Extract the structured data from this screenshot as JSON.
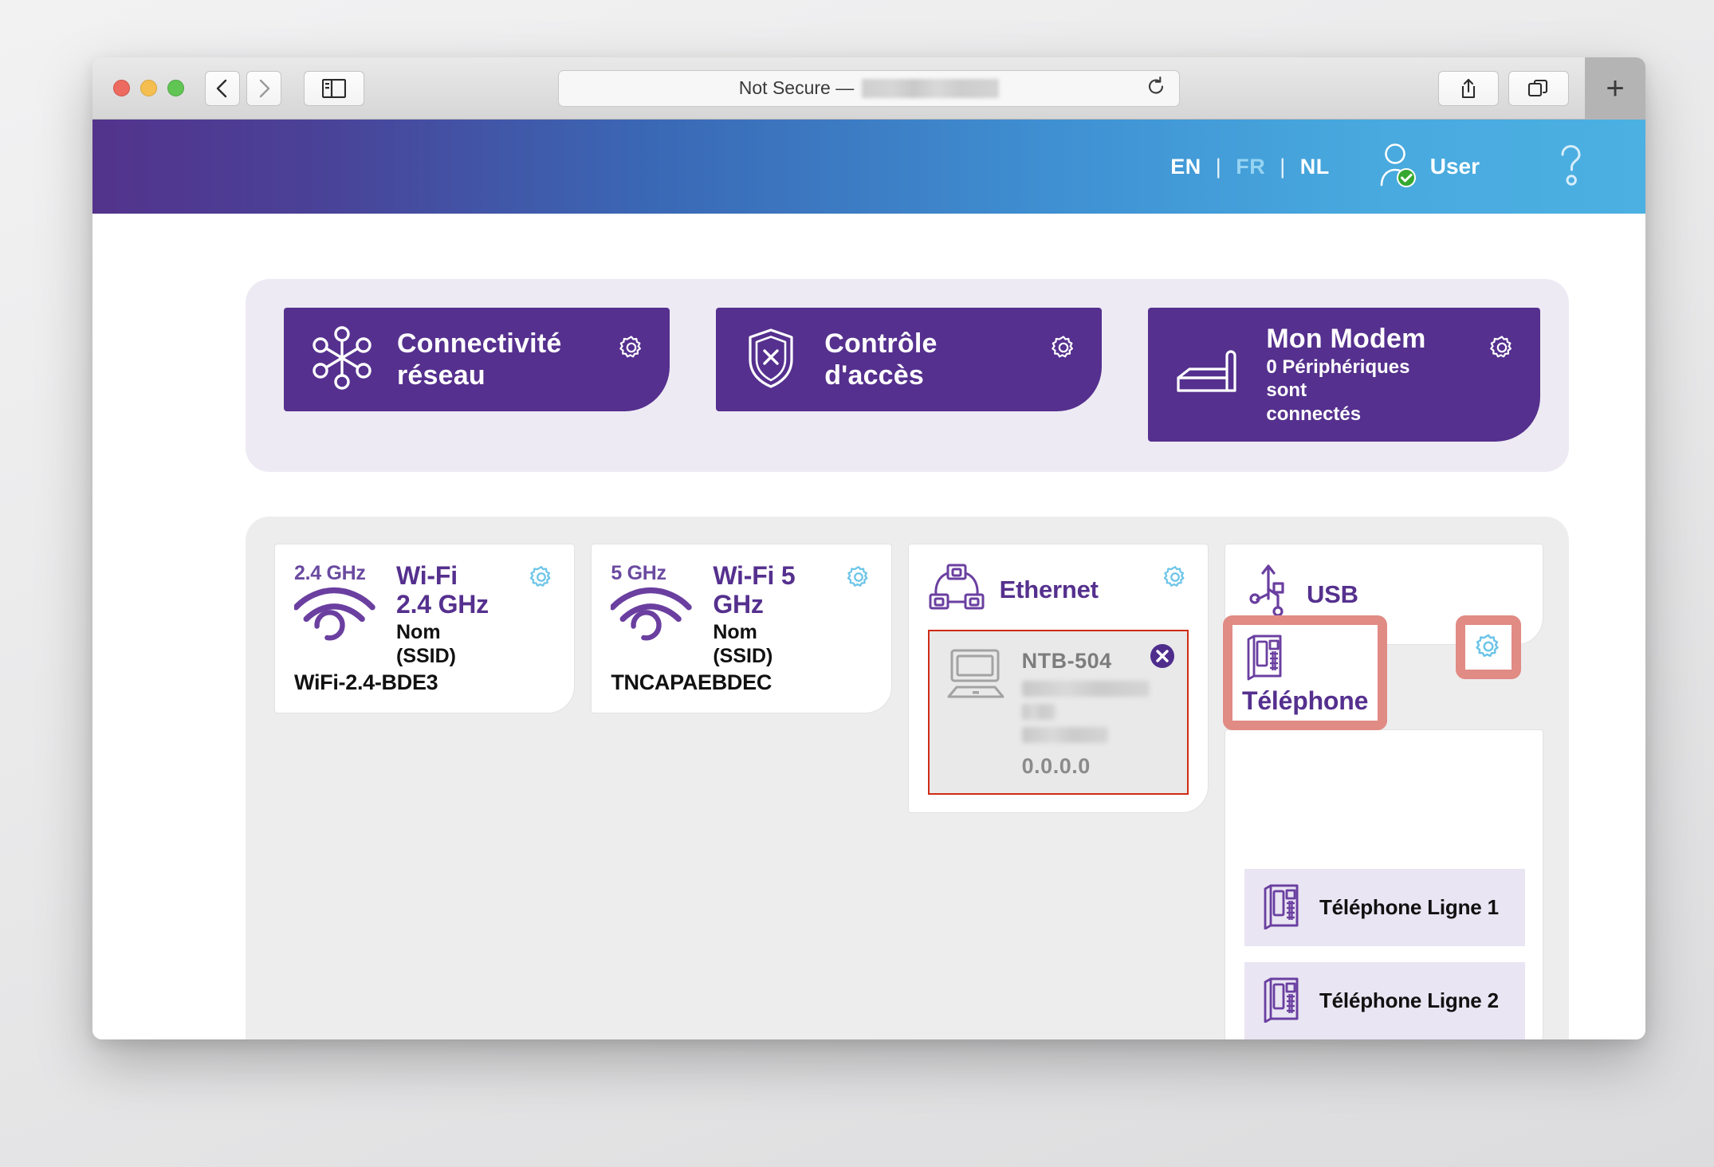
{
  "browser": {
    "url_prefix": "Not Secure — ",
    "url_redacted": true,
    "back_icon": "chevron-left-icon",
    "forward_icon": "chevron-right-icon",
    "sidebar_icon": "sidebar-icon",
    "reload_icon": "reload-icon",
    "share_icon": "share-icon",
    "tabs_icon": "tab-overview-icon",
    "newtab_label": "+"
  },
  "header": {
    "languages": [
      {
        "code": "EN",
        "active": false
      },
      {
        "code": "FR",
        "active": true
      },
      {
        "code": "NL",
        "active": false
      }
    ],
    "separator": "|",
    "user_label": "User",
    "user_icon": "user-verified-icon",
    "help_icon": "question-mark-icon",
    "gradient_start": "#53338c",
    "gradient_end": "#4cb0e2"
  },
  "top_cards": [
    {
      "title": "Connectivité",
      "title2": "réseau",
      "icon": "network-hub-icon",
      "gear_icon": "gear-icon"
    },
    {
      "title": "Contrôle d'accès",
      "title2": "",
      "icon": "shield-x-icon",
      "gear_icon": "gear-icon"
    },
    {
      "title": "Mon Modem",
      "subtitle_line1": "0 Périphériques sont",
      "subtitle_line2": "connectés",
      "icon": "modem-icon",
      "gear_icon": "gear-icon"
    }
  ],
  "wifi": [
    {
      "band_badge": "2.4 GHz",
      "title": "Wi-Fi",
      "title2": "2.4 GHz",
      "ssid_label_line1": "Nom",
      "ssid_label_line2": "(SSID)",
      "ssid_value": "WiFi-2.4-BDE3",
      "icon": "wifi-icon",
      "gear_icon": "gear-icon"
    },
    {
      "band_badge": "5 GHz",
      "title": "Wi-Fi 5",
      "title2": "GHz",
      "ssid_label_line1": "Nom",
      "ssid_label_line2": "(SSID)",
      "ssid_value": "TNCAPAEBDEC",
      "icon": "wifi-icon",
      "gear_icon": "gear-icon"
    }
  ],
  "ethernet": {
    "title": "Ethernet",
    "icon": "network-topology-icon",
    "gear_icon": "gear-icon",
    "device": {
      "name": "NTB-504",
      "icon": "laptop-icon",
      "ip": "0.0.0.0",
      "close_icon": "close-circle-icon",
      "redacted_lines": 3,
      "highlight_color": "#cf2b14"
    }
  },
  "usb": {
    "title": "USB",
    "icon": "usb-icon"
  },
  "phone": {
    "title": "Téléphone",
    "icon": "desk-phone-icon",
    "gear_icon": "gear-icon",
    "highlight_color": "#e08b84",
    "lines": [
      {
        "label": "Téléphone Ligne 1",
        "icon": "desk-phone-icon"
      },
      {
        "label": "Téléphone Ligne 2",
        "icon": "desk-phone-icon"
      }
    ]
  },
  "theme": {
    "purple": "#55308e",
    "light_purple_panel": "#edeaf4",
    "gray_panel": "#ededee",
    "gear_blue": "#6dc5e8",
    "lavender_row": "#e9e5f3"
  }
}
